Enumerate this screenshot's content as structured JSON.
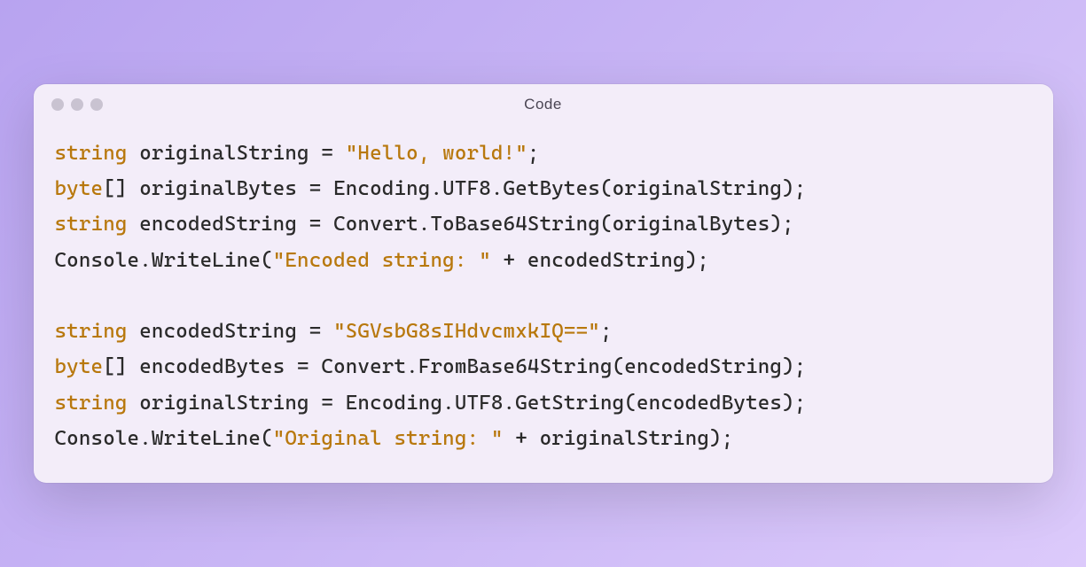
{
  "window": {
    "title": "Code"
  },
  "code": {
    "line1": {
      "kw": "string",
      "text": " originalString = ",
      "str": "\"Hello, world!\"",
      "end": ";"
    },
    "line2": {
      "kw": "byte",
      "br": "[] ",
      "text": "originalBytes = Encoding.UTF8.GetBytes(originalString);"
    },
    "line3": {
      "kw": "string",
      "text": " encodedString = Convert.ToBase64String(originalBytes);"
    },
    "line4": {
      "pre": "Console.WriteLine(",
      "str": "\"Encoded string: \"",
      "post": " + encodedString);"
    },
    "blank": "",
    "line5": {
      "kw": "string",
      "text": " encodedString = ",
      "str": "\"SGVsbG8sIHdvcmxkIQ==\"",
      "end": ";"
    },
    "line6": {
      "kw": "byte",
      "br": "[] ",
      "text": "encodedBytes = Convert.FromBase64String(encodedString);"
    },
    "line7": {
      "kw": "string",
      "text": " originalString = Encoding.UTF8.GetString(encodedBytes);"
    },
    "line8": {
      "pre": "Console.WriteLine(",
      "str": "\"Original string: \"",
      "post": " + originalString);"
    }
  }
}
